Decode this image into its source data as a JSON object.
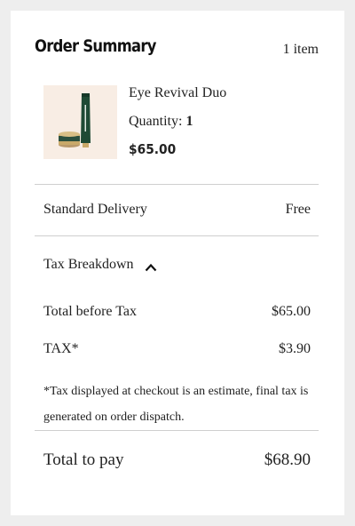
{
  "summary": {
    "title": "Order Summary",
    "item_count": "1 item"
  },
  "product": {
    "name": "Eye Revival Duo",
    "quantity_label": "Quantity:",
    "quantity_value": "1",
    "price": "$65.00"
  },
  "delivery": {
    "label": "Standard Delivery",
    "value": "Free"
  },
  "tax": {
    "toggle_label": "Tax Breakdown",
    "toggle_icon": "chevron-up-icon",
    "total_before_tax_label": "Total before Tax",
    "total_before_tax_value": "$65.00",
    "tax_label": "TAX*",
    "tax_value": "$3.90",
    "note": "*Tax displayed at checkout is an estimate, final tax is generated on order dispatch."
  },
  "total": {
    "label": "Total to pay",
    "value": "$68.90"
  },
  "colors": {
    "background": "#eeeeee",
    "card": "#ffffff",
    "text": "#222222",
    "thumb_background": "#f8ede4",
    "tube_green": "#1f4a35",
    "jar_gold": "#c9a96a"
  }
}
